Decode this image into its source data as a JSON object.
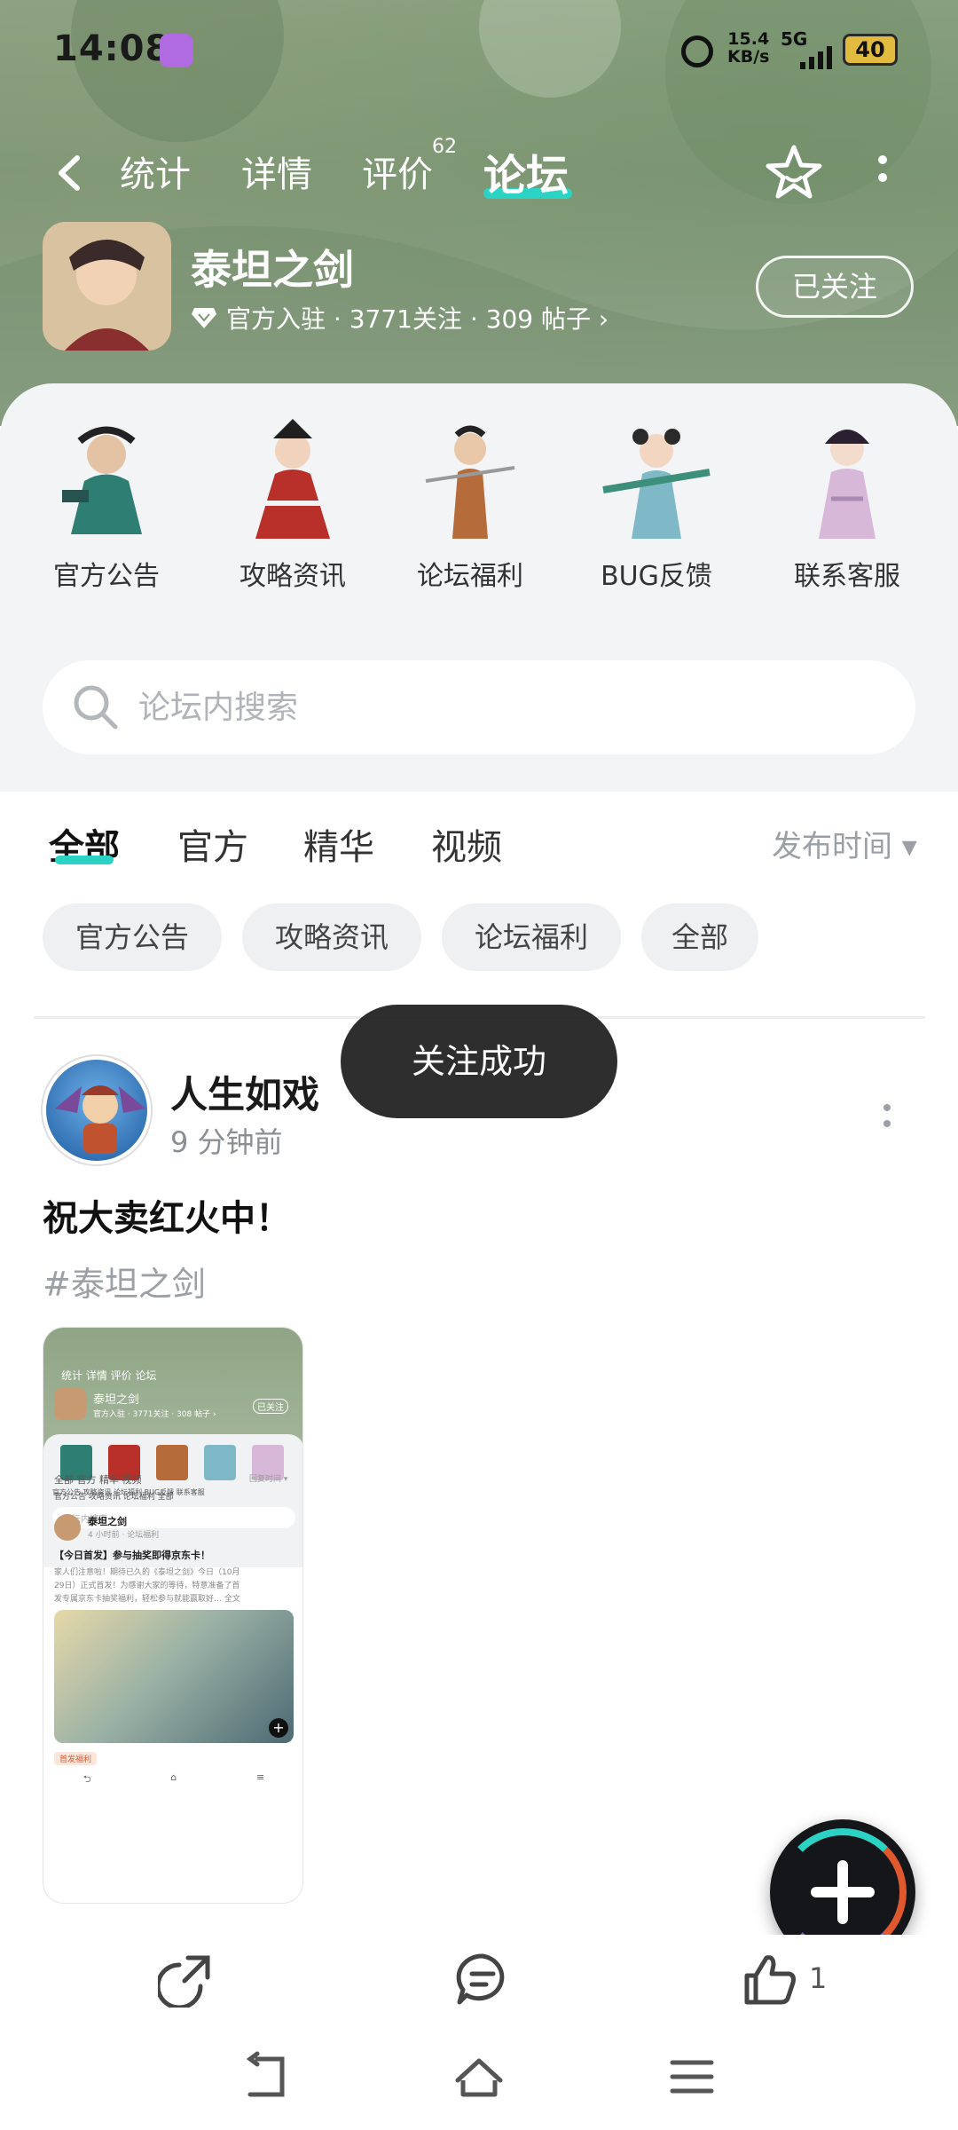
{
  "status_bar": {
    "time": "14:08",
    "speed_value": "15.4",
    "speed_unit": "KB/s",
    "network": "5G",
    "battery": "40"
  },
  "top_nav": {
    "tabs": [
      {
        "label": "统计"
      },
      {
        "label": "详情"
      },
      {
        "label": "评价",
        "badge": "62"
      },
      {
        "label": "论坛",
        "active": true
      }
    ]
  },
  "game": {
    "title": "泰坦之剑",
    "meta": "官方入驻 · 3771关注 · 309 帖子 ›",
    "follow_label": "已关注"
  },
  "categories": [
    {
      "label": "官方公告"
    },
    {
      "label": "攻略资讯"
    },
    {
      "label": "论坛福利"
    },
    {
      "label": "BUG反馈"
    },
    {
      "label": "联系客服"
    }
  ],
  "search": {
    "placeholder": "论坛内搜索"
  },
  "filter": {
    "tabs": [
      {
        "label": "全部",
        "active": true
      },
      {
        "label": "官方"
      },
      {
        "label": "精华"
      },
      {
        "label": "视频"
      }
    ],
    "sort_label": "发布时间 ▾",
    "chips": [
      {
        "label": "官方公告"
      },
      {
        "label": "攻略资讯"
      },
      {
        "label": "论坛福利"
      },
      {
        "label": "全部"
      }
    ]
  },
  "post": {
    "username": "人生如戏",
    "time": "9 分钟前",
    "title": "祝大卖红火中！",
    "tag": "#泰坦之剑",
    "like_count": "1"
  },
  "toast": {
    "text": "关注成功"
  },
  "thumbnail": {
    "tabs": "统计  详情  评价  论坛",
    "game_title": "泰坦之剑",
    "meta": "官方入驻 · 3771关注 · 308 帖子 ›",
    "follow_label": "已关注",
    "categories": "官方公告   攻略资讯   论坛福利   BUG反馈   联系客服",
    "search": "论坛内搜索",
    "filter_tabs": "全部    官方    精华    视频",
    "sort_label": "回复时间 ▾",
    "chips": "官方公告   攻略资讯   论坛福利   全部",
    "post_author": "泰坦之剑",
    "post_meta": "4 小时前 · 论坛福利",
    "post_title": "【今日首发】参与抽奖即得京东卡！",
    "post_body_1": "家人们注意啦！期待已久的《泰坦之剑》今日（10月",
    "post_body_2": "29日）正式首发！为感谢大家的等待，特意准备了首",
    "post_body_3": "发专属京东卡抽奖福利，轻松参与就能赢取好… 全文",
    "footer_tag": "首发福利"
  },
  "colors": {
    "accent": "#2bd3c4",
    "toast_bg": "#1e1e1e"
  }
}
